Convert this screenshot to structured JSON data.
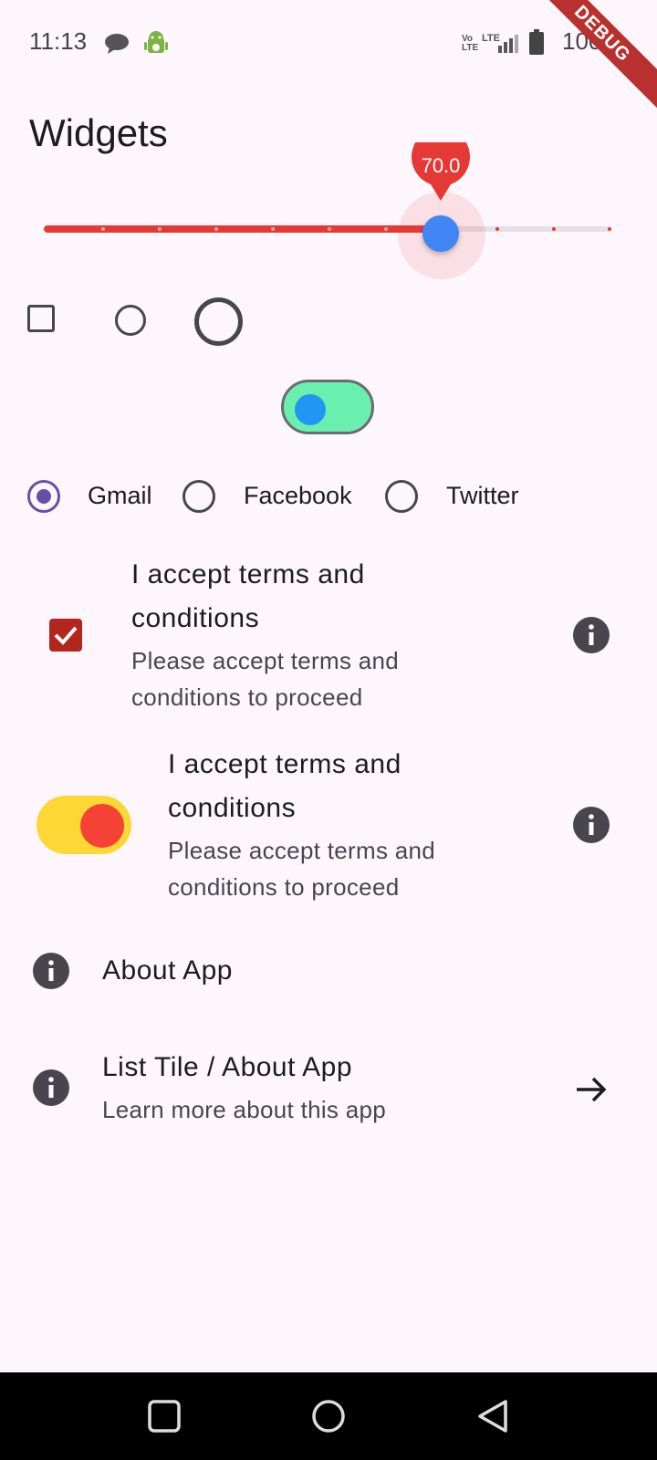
{
  "status_bar": {
    "time": "11:13",
    "battery": "100%",
    "network_labels": [
      "Vo LTE",
      "LTE"
    ]
  },
  "debug_banner": "DEBUG",
  "page": {
    "title": "Widgets"
  },
  "slider": {
    "value_label": "70.0",
    "value": 70,
    "min": 0,
    "max": 100,
    "divisions": 10,
    "active_color": "#e53935",
    "thumb_color": "#4285f4"
  },
  "controls": {
    "checkbox_checked": false,
    "small_radio_selected": false,
    "large_radio_selected": false
  },
  "center_switch": {
    "on": true,
    "track_color": "#69f0ae",
    "thumb_color": "#2196f3"
  },
  "radio_group": {
    "selected": "Gmail",
    "options": [
      "Gmail",
      "Facebook",
      "Twitter"
    ],
    "accent": "#6750a4"
  },
  "checkbox_tile": {
    "checked": true,
    "title": [
      "I accept terms and",
      "conditions"
    ],
    "subtitle": [
      "Please accept terms and",
      "conditions to proceed"
    ],
    "secondary_icon": "info-icon",
    "check_color": "#b3261e"
  },
  "switch_tile": {
    "on": true,
    "title": [
      "I accept terms and",
      "conditions"
    ],
    "subtitle": [
      "Please accept terms and",
      "conditions to proceed"
    ],
    "secondary_icon": "info-icon",
    "track_color": "#fdd835",
    "thumb_color": "#f44336"
  },
  "about_tile": {
    "title": "About App",
    "leading_icon": "info-icon"
  },
  "list_tile": {
    "title": "List Tile / About App",
    "subtitle": "Learn more about this app",
    "leading_icon": "info-icon",
    "trailing_icon": "arrow-forward-icon"
  },
  "nav_bar": {
    "buttons": [
      "recents-button",
      "home-button",
      "back-button"
    ]
  }
}
